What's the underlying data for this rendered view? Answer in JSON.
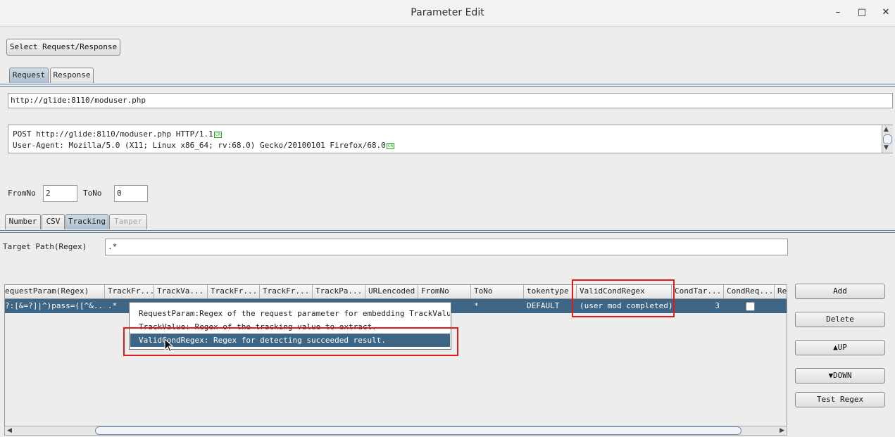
{
  "window": {
    "title": "Parameter Edit",
    "minimize": "–",
    "maximize": "□",
    "close": "✕"
  },
  "select_button": "Select Request/Response",
  "top_tabs": [
    "Request",
    "Response"
  ],
  "url": "http://glide:8110/moduser.php",
  "request_lines": [
    "POST http://glide:8110/moduser.php HTTP/1.1",
    "User-Agent: Mozilla/5.0 (X11; Linux x86_64; rv:68.0) Gecko/20100101 Firefox/68.0"
  ],
  "cr_marker": "CR",
  "range": {
    "from_label": "FromNo",
    "from_value": "2",
    "to_label": "ToNo",
    "to_value": "0"
  },
  "mode_tabs": [
    "Number",
    "CSV",
    "Tracking",
    "Tamper"
  ],
  "target_path": {
    "label": "Target Path(Regex)",
    "value": ".*"
  },
  "table": {
    "columns": [
      "equestParam(Regex)",
      "TrackFr...",
      "TrackVa...",
      "TrackFr...",
      "TrackFr...",
      "TrackPa...",
      "URLencoded",
      "FromNo",
      "ToNo",
      "tokentype",
      "ValidCondRegex",
      "CondTar...",
      "CondReq...",
      "Re"
    ],
    "row": {
      "request_param": "?:[&=?]|^)pass=([^&...",
      "track_from": ".*",
      "to_no": "*",
      "tokentype": "DEFAULT",
      "valid_cond_regex": "(user mod completed)",
      "cond_target": "3"
    }
  },
  "tooltip": {
    "lines": [
      "RequestParam:Regex of the request parameter for embedding TrackValue to.",
      "TrackValue: Regex of the tracking value to extract.",
      "ValidCondRegex: Regex for detecting succeeded result."
    ]
  },
  "side_buttons": {
    "add": "Add",
    "delete": "Delete",
    "up": "▲UP",
    "down": "▼DOWN",
    "test_regex": "Test Regex"
  }
}
